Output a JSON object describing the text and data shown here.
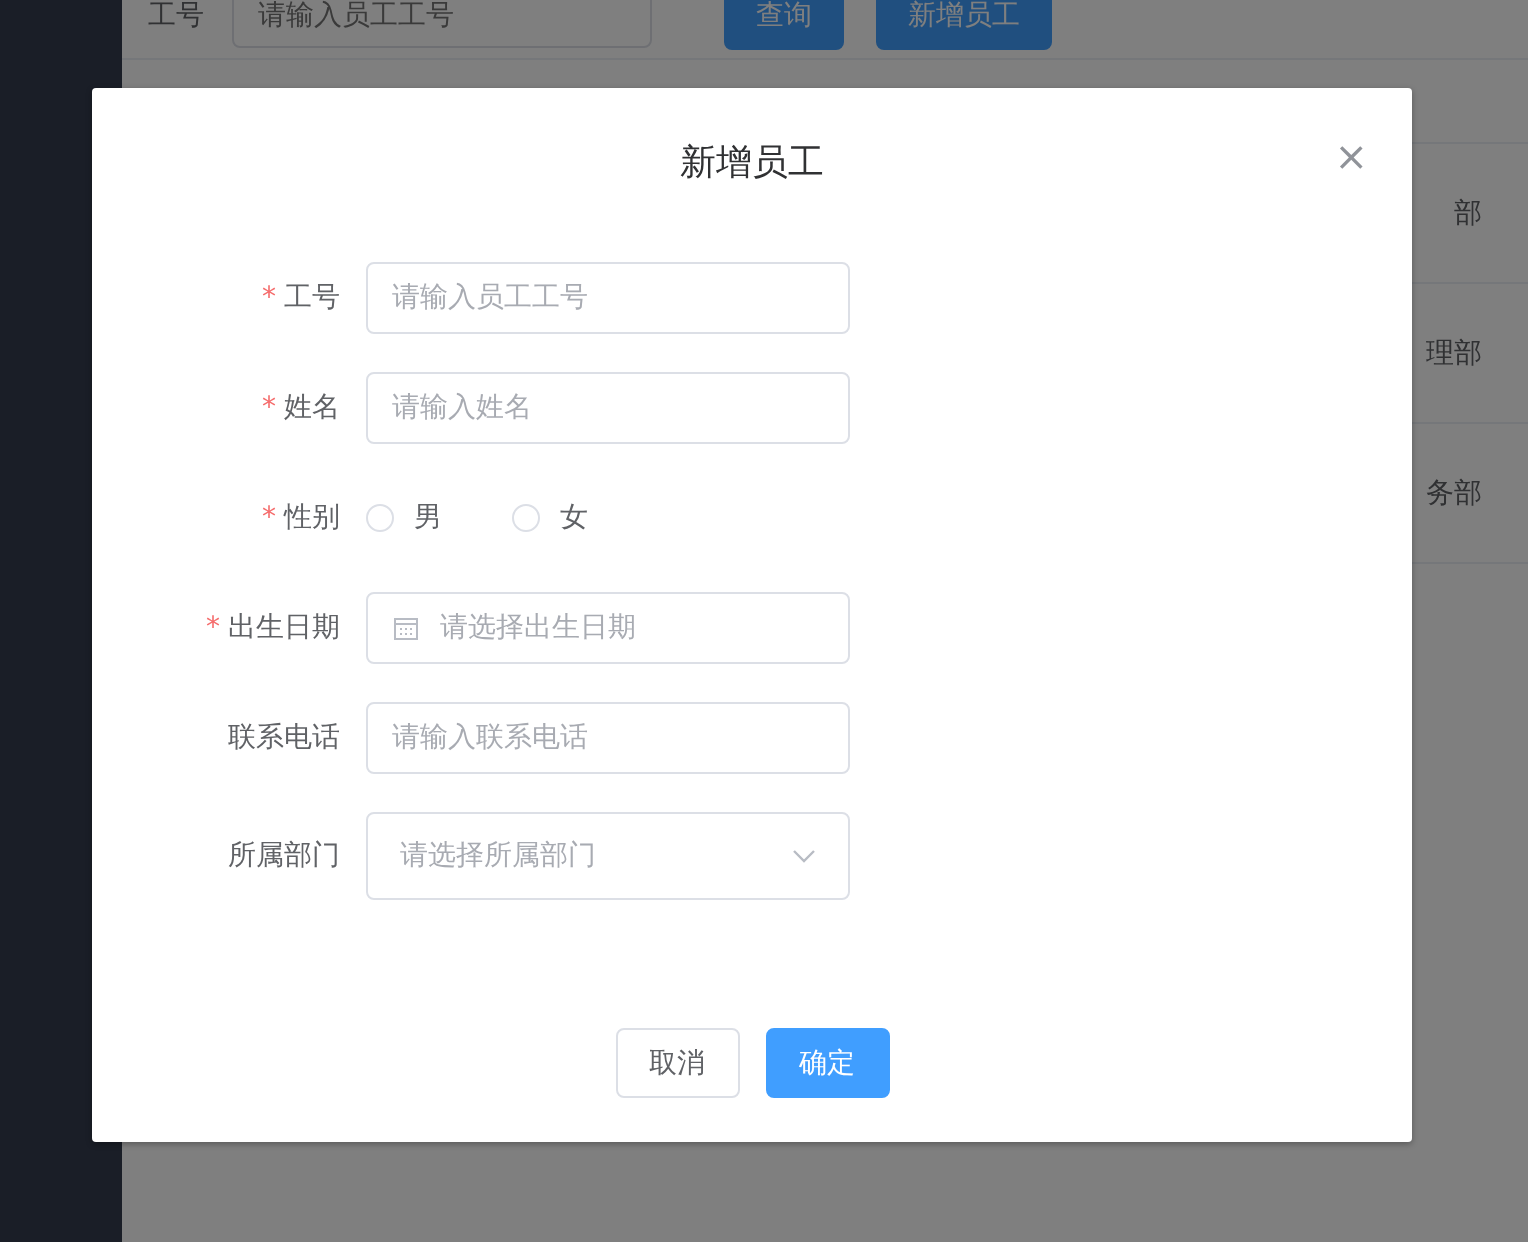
{
  "background": {
    "search_bar": {
      "label": "工号",
      "placeholder": "请输入员工工号",
      "buttons": [
        "查询",
        "新增员工"
      ]
    },
    "table": {
      "rows": [
        {
          "column_1": "部"
        },
        {
          "column_1": "理部"
        },
        {
          "column_1": "务部"
        }
      ]
    }
  },
  "dialog": {
    "title": "新增员工",
    "close": "×",
    "fields": [
      {
        "kind": "text",
        "label": "工号",
        "required_mark": "*",
        "placeholder": "请输入员工工号"
      },
      {
        "kind": "text",
        "label": "姓名",
        "required_mark": "*",
        "placeholder": "请输入姓名"
      },
      {
        "kind": "radio",
        "label": "性别",
        "required_mark": "*",
        "options": [
          {
            "label": "男",
            "selected": false
          },
          {
            "label": "女",
            "selected": false
          }
        ]
      },
      {
        "kind": "date",
        "label": "出生日期",
        "required_mark": "*",
        "placeholder": "请选择出生日期"
      },
      {
        "kind": "text",
        "label": "联系电话",
        "placeholder": "请输入联系电话"
      },
      {
        "kind": "select",
        "label": "所属部门",
        "placeholder": "请选择所属部门"
      }
    ],
    "buttons": [
      {
        "kind": "secondary",
        "label": "取消"
      },
      {
        "kind": "primary",
        "label": "确定"
      }
    ]
  }
}
